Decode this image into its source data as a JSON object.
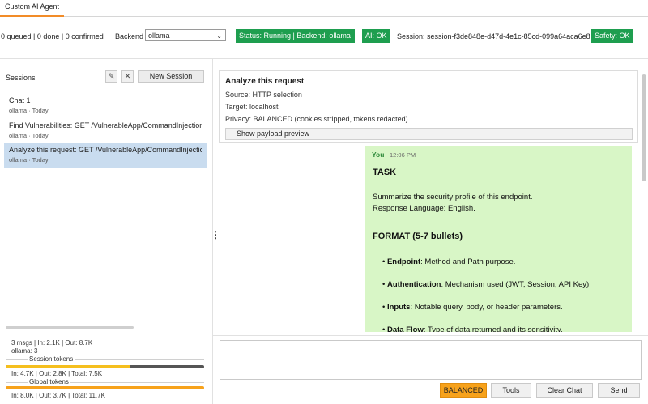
{
  "tab": {
    "label": "Custom AI Agent"
  },
  "topbar": {
    "queue_status": "0 queued | 0 done | 0 confirmed",
    "backend_label": "Backend",
    "backend_value": "ollama",
    "status_badge": "Status: Running | Backend: ollama",
    "ai_badge": "AI: OK",
    "session_id": "Session: session-f3de848e-d47d-4e1c-85cd-099a64aca6e8",
    "safety_badge": "Safety: OK"
  },
  "sidebar": {
    "title": "Sessions",
    "edit_icon": "✎",
    "close_icon": "✕",
    "new_session_label": "New Session",
    "sessions": [
      {
        "name": "Chat 1",
        "meta": "ollama · Today"
      },
      {
        "name": "Find Vulnerabilities: GET /VulnerableApp/CommandInjection",
        "meta": "ollama · Today"
      },
      {
        "name": "Analyze this request: GET /VulnerableApp/CommandInjection",
        "meta": "ollama · Today"
      }
    ],
    "stats": {
      "messages": "3 msgs | In: 2.1K | Out: 8.7K",
      "backend_count": "ollama: 3",
      "session_tokens_label": "Session tokens",
      "session_tokens": "In: 4.7K | Out: 2.8K | Total: 7.5K",
      "global_tokens_label": "Global tokens",
      "global_tokens": "In: 8.0K | Out: 3.7K | Total: 11.7K",
      "session_in_fraction": 0.63,
      "global_in_fraction": 1.0
    }
  },
  "request_info": {
    "title": "Analyze this request",
    "source": "Source: HTTP selection",
    "target": "Target: localhost",
    "privacy": "Privacy: BALANCED (cookies stripped, tokens redacted)",
    "payload_button": "Show payload preview"
  },
  "message": {
    "author": "You",
    "time": "12:06 PM",
    "task_heading": "TASK",
    "task_line1": "Summarize the security profile of this endpoint.",
    "task_line2": "Response Language: English.",
    "format_heading": "FORMAT (5-7 bullets)",
    "bullets": [
      {
        "bullet": "•",
        "term": "Endpoint",
        "text": ": Method and Path purpose."
      },
      {
        "bullet": "•",
        "term": "Authentication",
        "text": ": Mechanism used (JWT, Session, API Key)."
      },
      {
        "bullet": "•",
        "term": "Inputs",
        "text": ": Notable query, body, or header parameters."
      },
      {
        "bullet": "•",
        "term": "Data Flow",
        "text": ": Type of data returned and its sensitivity."
      }
    ]
  },
  "composer": {
    "privacy_mode": "BALANCED",
    "tools_label": "Tools",
    "clear_label": "Clear Chat",
    "send_label": "Send"
  },
  "colors": {
    "accent": "#f28c28",
    "ok_green": "#1e9e4f",
    "selection": "#c9dcef",
    "bubble": "#d8f6c6",
    "balanced": "#f7a21b"
  }
}
